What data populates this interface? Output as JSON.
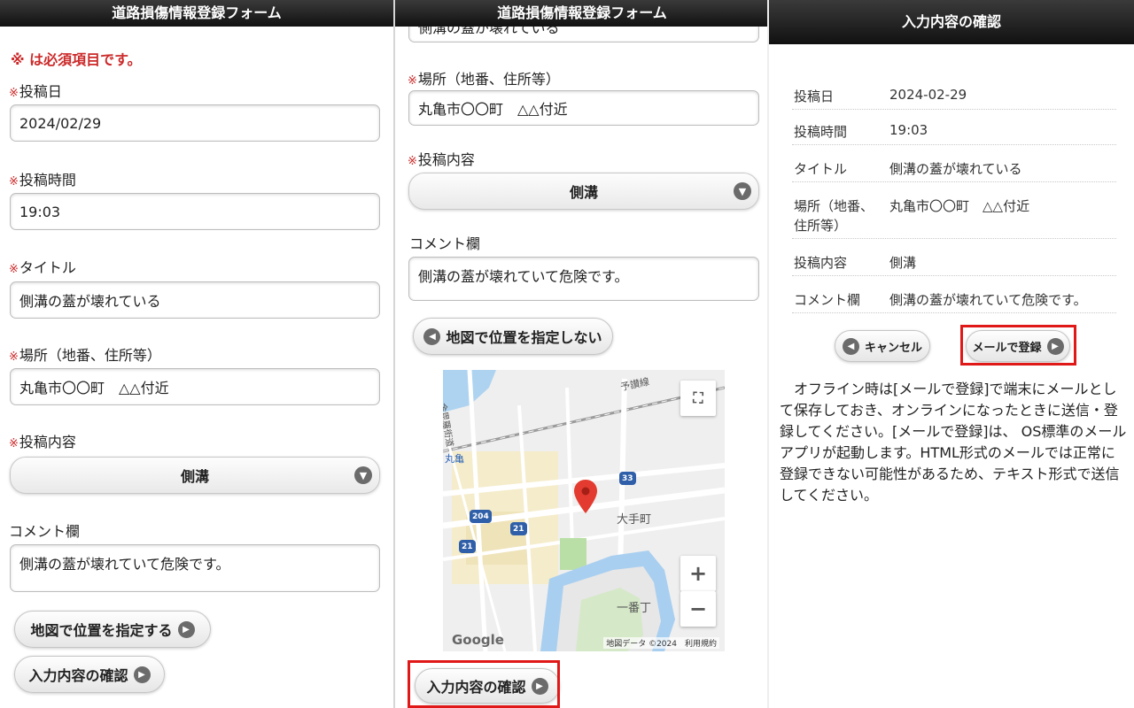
{
  "panel1": {
    "header": "道路損傷情報登録フォーム",
    "required_notice": "※ は必須項目です。",
    "required_mark": "※",
    "fields": {
      "date_label": "投稿日",
      "date_value": "2024/02/29",
      "time_label": "投稿時間",
      "time_value": "19:03",
      "title_label": "タイトル",
      "title_value": "側溝の蓋が壊れている",
      "location_label": "場所（地番、住所等）",
      "location_value": "丸亀市〇〇町　△△付近",
      "content_label": "投稿内容",
      "content_value": "側溝",
      "comment_label": "コメント欄",
      "comment_value": "側溝の蓋が壊れていて危険です。"
    },
    "map_button": "地図で位置を指定する",
    "confirm_button": "入力内容の確認"
  },
  "panel2": {
    "header": "道路損傷情報登録フォーム",
    "cut_value": "側溝の蓋が壊れている",
    "location_label": "場所（地番、住所等）",
    "location_value": "丸亀市〇〇町　△△付近",
    "content_label": "投稿内容",
    "content_value": "側溝",
    "comment_label": "コメント欄",
    "comment_value": "側溝の蓋が壊れていて危険です。",
    "map_button": "地図で位置を指定しない",
    "confirm_button": "入力内容の確認",
    "map": {
      "rail_label": "予讃線",
      "station_label": "丸亀",
      "street_label": "金毘羅街道",
      "district_1": "大手町",
      "district_2": "一番丁",
      "route_badges": [
        "33",
        "204",
        "21",
        "21"
      ],
      "logo": "Google",
      "attribution": "地図データ ©2024　利用規約"
    }
  },
  "panel3": {
    "header": "入力内容の確認",
    "rows": [
      {
        "key": "投稿日",
        "value": "2024-02-29"
      },
      {
        "key": "投稿時間",
        "value": "19:03"
      },
      {
        "key": "タイトル",
        "value": "側溝の蓋が壊れている"
      },
      {
        "key": "場所（地番、住所等）",
        "value": "丸亀市〇〇町　△△付近"
      },
      {
        "key": "投稿内容",
        "value": "側溝"
      },
      {
        "key": "コメント欄",
        "value": "側溝の蓋が壊れていて危険です。"
      }
    ],
    "cancel_button": "キャンセル",
    "mail_button": "メールで登録",
    "paragraph": "オフライン時は[メールで登録]で端末にメールとして保存しておき、オンラインになったときに送信・登録してください。[メールで登録]は、 OS標準のメールアプリが起動します。HTML形式のメールでは正常に登録できない可能性があるため、テキスト形式で送信してください。"
  },
  "colors": {
    "required": "#cc2a2a",
    "highlight": "#e01818",
    "header_bg": "#1a1a1a",
    "map_pin": "#e33b2f",
    "route_badge": "#2f5fa8"
  }
}
